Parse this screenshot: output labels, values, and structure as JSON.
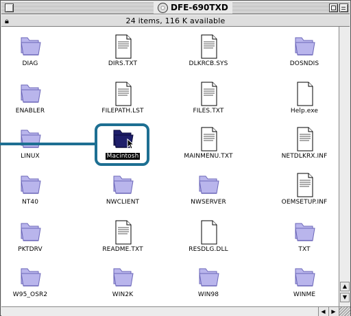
{
  "window": {
    "title": "DFE-690TXD",
    "info": "24 items, 116 K available"
  },
  "items": [
    {
      "name": "DIAG",
      "type": "folder"
    },
    {
      "name": "DIRS.TXT",
      "type": "text"
    },
    {
      "name": "DLKRCB.SYS",
      "type": "text"
    },
    {
      "name": "DOSNDIS",
      "type": "folder"
    },
    {
      "name": "ENABLER",
      "type": "folder"
    },
    {
      "name": "FILEPATH.LST",
      "type": "text"
    },
    {
      "name": "FILES.TXT",
      "type": "text"
    },
    {
      "name": "Help.exe",
      "type": "blank"
    },
    {
      "name": "LINUX",
      "type": "folder"
    },
    {
      "name": "Macintosh",
      "type": "folder-selected"
    },
    {
      "name": "MAINMENU.TXT",
      "type": "text"
    },
    {
      "name": "NETDLKRX.INF",
      "type": "text"
    },
    {
      "name": "NT40",
      "type": "folder"
    },
    {
      "name": "NWCLIENT",
      "type": "folder"
    },
    {
      "name": "NWSERVER",
      "type": "folder"
    },
    {
      "name": "OEMSETUP.INF",
      "type": "text"
    },
    {
      "name": "PKTDRV",
      "type": "folder"
    },
    {
      "name": "README.TXT",
      "type": "text"
    },
    {
      "name": "RESDLG.DLL",
      "type": "blank"
    },
    {
      "name": "TXT",
      "type": "folder"
    },
    {
      "name": "W95_OSR2",
      "type": "folder"
    },
    {
      "name": "WIN2K",
      "type": "folder"
    },
    {
      "name": "WIN98",
      "type": "folder"
    },
    {
      "name": "WINME",
      "type": "folder"
    }
  ],
  "icons": {
    "close": "close-box-icon",
    "zoom": "zoom-box-icon",
    "collapse": "collapse-box-icon",
    "disk": "cd-disk-icon",
    "lock": "lock-icon"
  },
  "colors": {
    "folder": "#b9b5ec",
    "folder_selected": "#1e1e6a",
    "callout": "#1d6f92"
  }
}
